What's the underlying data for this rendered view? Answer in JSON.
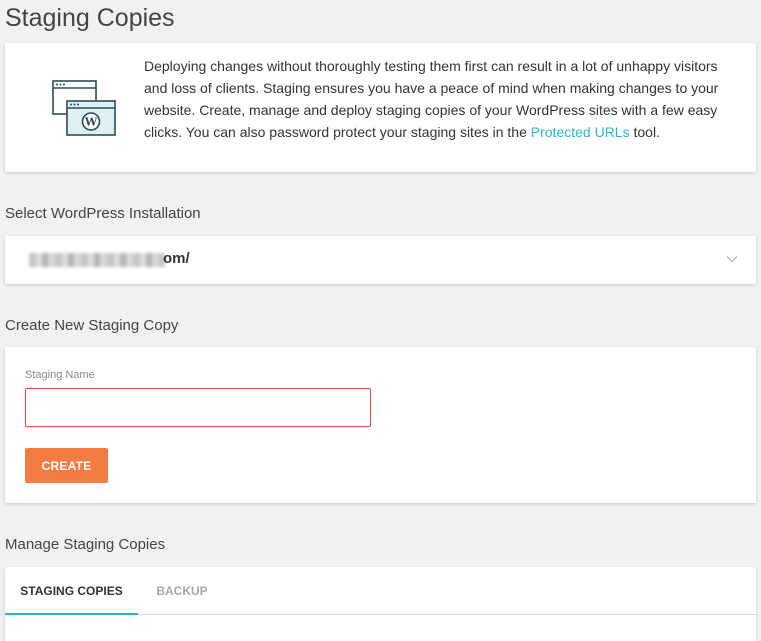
{
  "page": {
    "title": "Staging Copies"
  },
  "info": {
    "text": "Deploying changes without thoroughly testing them first can result in a lot of unhappy visitors and loss of clients. Staging ensures you have a peace of mind when making changes to your website. Create, manage and deploy staging copies of your WordPress sites with a few easy clicks. You can also password protect your staging sites in the",
    "link_label": "Protected URLs",
    "suffix": " tool.",
    "icon": "staging-windows-wordpress-icon"
  },
  "select_section": {
    "title": "Select WordPress Installation",
    "value_suffix": "om/",
    "chevron_icon": "chevron-down-icon"
  },
  "create_section": {
    "title": "Create New Staging Copy",
    "field_label": "Staging Name",
    "input_value": "",
    "button_label": "CREATE"
  },
  "manage_section": {
    "title": "Manage Staging Copies",
    "tabs": [
      {
        "label": "STAGING COPIES",
        "active": true
      },
      {
        "label": "BACKUP",
        "active": false
      }
    ]
  },
  "colors": {
    "accent": "#2fb5c5",
    "button": "#f47c43",
    "input_error_border": "#e0533d",
    "background": "#f1f1f1"
  }
}
